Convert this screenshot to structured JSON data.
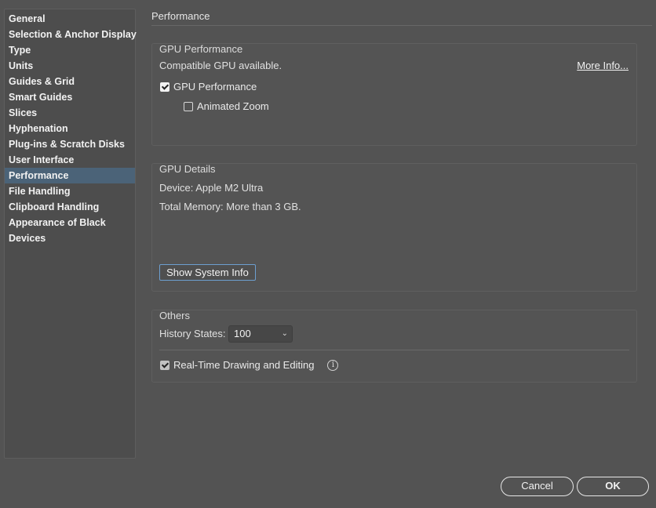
{
  "sidebar": {
    "items": [
      {
        "label": "General"
      },
      {
        "label": "Selection & Anchor Display"
      },
      {
        "label": "Type"
      },
      {
        "label": "Units"
      },
      {
        "label": "Guides & Grid"
      },
      {
        "label": "Smart Guides"
      },
      {
        "label": "Slices"
      },
      {
        "label": "Hyphenation"
      },
      {
        "label": "Plug-ins & Scratch Disks"
      },
      {
        "label": "User Interface"
      },
      {
        "label": "Performance",
        "selected": true
      },
      {
        "label": "File Handling"
      },
      {
        "label": "Clipboard Handling"
      },
      {
        "label": "Appearance of Black"
      },
      {
        "label": "Devices"
      }
    ]
  },
  "main": {
    "title": "Performance",
    "gpu_performance": {
      "title": "GPU Performance",
      "status": "Compatible GPU available.",
      "more_info_link": "More Info...",
      "gpu_performance_checkbox": {
        "label": "GPU Performance",
        "checked": true
      },
      "animated_zoom_checkbox": {
        "label": "Animated Zoom",
        "checked": false
      }
    },
    "gpu_details": {
      "title": "GPU Details",
      "device": "Device: Apple M2 Ultra",
      "total_memory": "Total Memory:  More than 3 GB.",
      "show_system_info_button": "Show System Info"
    },
    "others": {
      "title": "Others",
      "history_states_label": "History States:",
      "history_states_value": "100",
      "realtime_checkbox": {
        "label": "Real-Time Drawing and Editing",
        "checked": true
      }
    }
  },
  "footer": {
    "cancel_label": "Cancel",
    "ok_label": "OK"
  },
  "icons": {
    "info": "info-icon",
    "dropdown": "chevron-down-icon"
  }
}
